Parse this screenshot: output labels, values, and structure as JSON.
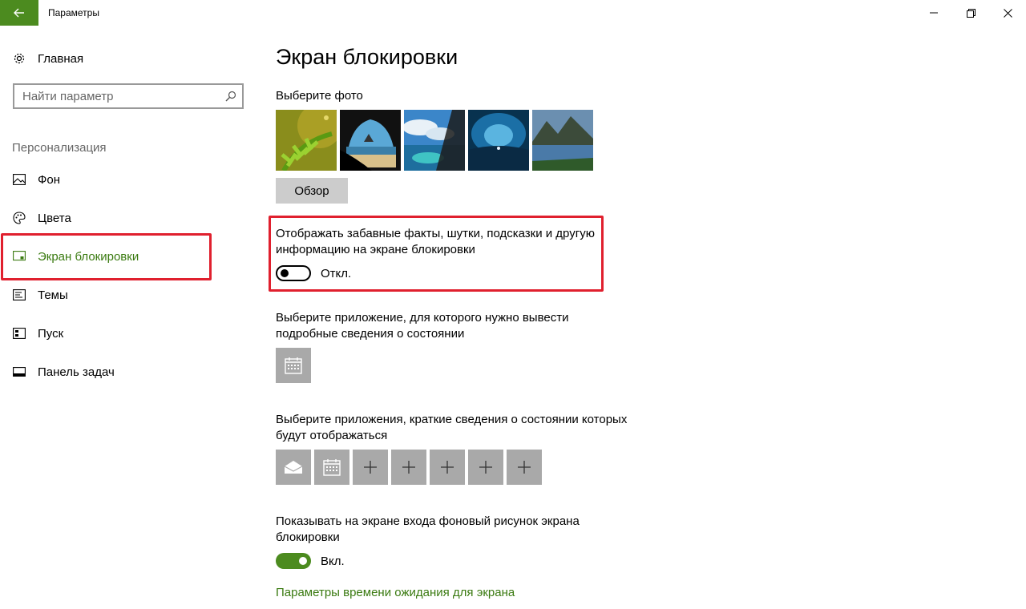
{
  "window": {
    "title": "Параметры",
    "back_icon": "back-arrow-icon",
    "accent_color": "#4c8b1f",
    "highlight_color": "#e0202e"
  },
  "sidebar": {
    "home_label": "Главная",
    "search_placeholder": "Найти параметр",
    "section_label": "Персонализация",
    "items": [
      {
        "label": "Фон",
        "icon": "picture-icon"
      },
      {
        "label": "Цвета",
        "icon": "palette-icon"
      },
      {
        "label": "Экран блокировки",
        "icon": "lock-screen-icon",
        "active": true
      },
      {
        "label": "Темы",
        "icon": "themes-icon"
      },
      {
        "label": "Пуск",
        "icon": "start-icon"
      },
      {
        "label": "Панель задач",
        "icon": "taskbar-icon"
      }
    ]
  },
  "main": {
    "title": "Экран блокировки",
    "choose_photo_label": "Выберите фото",
    "photos": [
      "fern",
      "cave-beach",
      "sky-lagoon",
      "ice-cave",
      "mountain-lake"
    ],
    "browse_label": "Обзор",
    "fun_facts": {
      "line1": "Отображать забавные факты, шутки, подсказки и другую",
      "line2": "информацию на экране блокировки",
      "state_label": "Откл.",
      "on": false
    },
    "detailed_app": {
      "line1": "Выберите приложение, для которого нужно вывести",
      "line2": "подробные сведения о состоянии",
      "app_icon": "calendar-icon"
    },
    "quick_apps": {
      "line1": "Выберите приложения, краткие сведения о состоянии которых",
      "line2": "будут отображаться",
      "tiles": [
        "mail-icon",
        "calendar-icon",
        "plus-icon",
        "plus-icon",
        "plus-icon",
        "plus-icon",
        "plus-icon"
      ]
    },
    "signin_background": {
      "line1": "Показывать на экране входа фоновый рисунок экрана",
      "line2": "блокировки",
      "state_label": "Вкл.",
      "on": true
    },
    "timeout_link": "Параметры времени ожидания для экрана"
  }
}
